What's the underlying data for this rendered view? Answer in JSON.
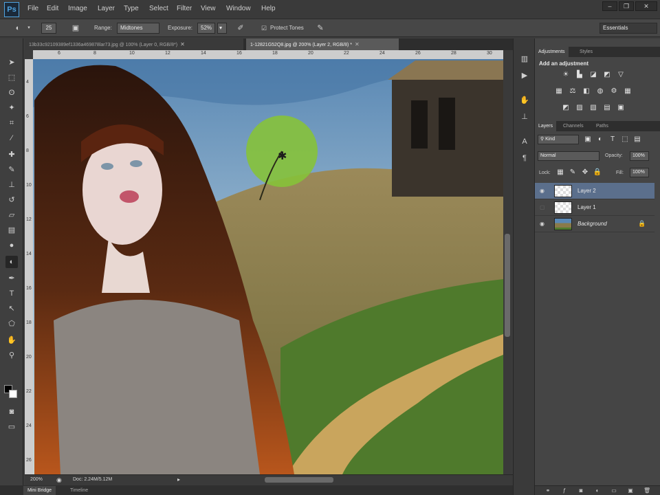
{
  "app": {
    "logo": "Ps",
    "workspace": "Essentials"
  },
  "menu": [
    "File",
    "Edit",
    "Image",
    "Layer",
    "Type",
    "Select",
    "Filter",
    "View",
    "Window",
    "Help"
  ],
  "window_controls": [
    "–",
    "❐",
    "✕"
  ],
  "options": {
    "brush_size": "25",
    "range_label": "Range:",
    "range_value": "Midtones",
    "exposure_label": "Exposure:",
    "exposure_value": "52%",
    "protect_tones_label": "Protect Tones"
  },
  "doc_tabs": [
    {
      "label": "13b33c92109389ef1336a469878lar73.jpg @ 100% (Layer 0, RGB/8*)",
      "active": false
    },
    {
      "label": "1-12821G52Q8.jpg @ 200% (Layer 2, RGB/8) *",
      "active": true
    }
  ],
  "ruler_top": [
    "6",
    "8",
    "10",
    "12",
    "14",
    "16",
    "18",
    "20",
    "22",
    "24",
    "26",
    "28",
    "30"
  ],
  "ruler_left": [
    "4",
    "6",
    "8",
    "10",
    "12",
    "14",
    "16",
    "18",
    "20",
    "22",
    "24",
    "26"
  ],
  "status": {
    "zoom": "200%",
    "doc": "Doc: 2.24M/5.12M"
  },
  "bottom_tabs": [
    "Mini Bridge",
    "Timeline"
  ],
  "panels": {
    "adjust_tabs": [
      "Adjustments",
      "Styles"
    ],
    "adjust_title": "Add an adjustment",
    "layers_tabs": [
      "Layers",
      "Channels",
      "Paths"
    ],
    "kind_label": "Kind",
    "blend_mode": "Normal",
    "opacity_label": "Opacity:",
    "opacity_value": "100%",
    "lock_label": "Lock:",
    "fill_label": "Fill:",
    "fill_value": "100%"
  },
  "layers": [
    {
      "name": "Layer 2",
      "visible": true,
      "selected": true
    },
    {
      "name": "Layer 1",
      "visible": false,
      "selected": false
    },
    {
      "name": "Background",
      "visible": true,
      "selected": false
    }
  ],
  "colors": {
    "accent": "#4fa3e0",
    "selected_layer": "#5b6f8c",
    "brush_cursor": "#86c23a"
  }
}
